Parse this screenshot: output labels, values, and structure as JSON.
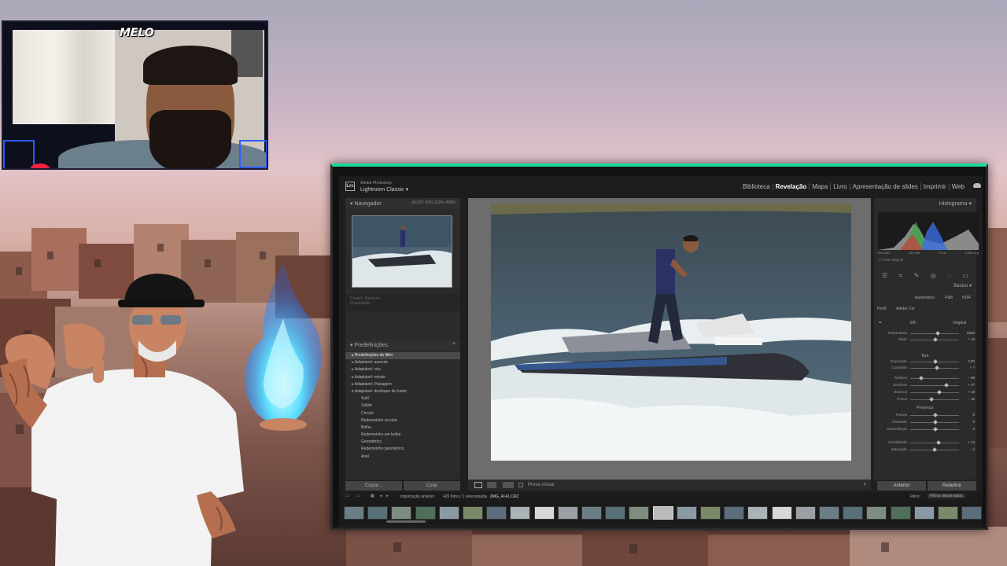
{
  "webcam": {
    "badge_text": "MELO"
  },
  "app": {
    "brand_small": "Adobe Photoshop",
    "title": "Lightroom Classic",
    "title_caret": "▾",
    "icon_text": "Lrc"
  },
  "modules": [
    "Biblioteca",
    "Revelação",
    "Mapa",
    "Livro",
    "Apresentação de slides",
    "Imprimir",
    "Web"
  ],
  "active_module": "Revelação",
  "left_panel": {
    "navigator_title": "Navegador",
    "navigator_options": "AJUST  50%  100%  400%",
    "snapshot_label": "Predef.: Nenhum",
    "snapshot_sub": "Quantidade",
    "presets_title": "Predefinições",
    "presets": [
      {
        "label": "▸ Predefinições do filtro",
        "sel": true
      },
      {
        "label": "▸ Adaptável: assunto",
        "sel": false
      },
      {
        "label": "▸ Adaptável: céu",
        "sel": false
      },
      {
        "label": "▸ Adaptável: retrato",
        "sel": false
      },
      {
        "label": "▸ Adaptável: Paisagem",
        "sel": false
      },
      {
        "label": "▾ Adaptável: desfoque de fundo",
        "sel": false
      },
      {
        "label": "Sutil",
        "sel": false,
        "indent": true
      },
      {
        "label": "Sólido",
        "sel": false,
        "indent": true
      },
      {
        "label": "Círculo",
        "sel": false,
        "indent": true
      },
      {
        "label": "Redemoinho circular",
        "sel": false,
        "indent": true
      },
      {
        "label": "Bolha",
        "sel": false,
        "indent": true
      },
      {
        "label": "Redemoinho em bolha",
        "sel": false,
        "indent": true
      },
      {
        "label": "Geométrico",
        "sel": false,
        "indent": true
      },
      {
        "label": "Redemoinho geométrico",
        "sel": false,
        "indent": true
      },
      {
        "label": "Anel",
        "sel": false,
        "indent": true
      }
    ],
    "copy_button": "Copiar...",
    "paste_button": "Colar"
  },
  "toolbar": {
    "proof_label": "Prova virtual"
  },
  "right_panel": {
    "histogram_title": "Histograma",
    "histo_labels": [
      "ISO 400",
      "300 mm",
      "f/ 5.6",
      "1/250 seg"
    ],
    "original_photo": "Foto Original",
    "basic_title": "Básico",
    "treatment_auto": "Automático",
    "treatment_pb": "P&B",
    "treatment_hdr": "HDR",
    "profile_label": "Perfil:",
    "profile_value": "Adobe Cor",
    "wb_label": "EB:",
    "wb_value": "Original",
    "tone_title": "Tom",
    "presence_title": "Presença",
    "sliders": [
      {
        "label": "Temperatura",
        "value": "5000",
        "pos": 0.55
      },
      {
        "label": "Matiz",
        "value": "+ 10",
        "pos": 0.5
      },
      {
        "label": "Exposição",
        "value": "0,00",
        "pos": 0.5
      },
      {
        "label": "Contraste",
        "value": "+ 7",
        "pos": 0.53
      },
      {
        "label": "Realces",
        "value": "− 59",
        "pos": 0.2
      },
      {
        "label": "Sombras",
        "value": "+ 47",
        "pos": 0.73
      },
      {
        "label": "Brancos",
        "value": "+ 18",
        "pos": 0.58
      },
      {
        "label": "Pretos",
        "value": "− 15",
        "pos": 0.42
      },
      {
        "label": "Textura",
        "value": "0",
        "pos": 0.5
      },
      {
        "label": "Claridade",
        "value": "0",
        "pos": 0.5
      },
      {
        "label": "Desembaçar",
        "value": "0",
        "pos": 0.5
      },
      {
        "label": "Vibratilidade",
        "value": "+ 14",
        "pos": 0.57
      },
      {
        "label": "Saturação",
        "value": "− 2",
        "pos": 0.49
      }
    ],
    "prev_button": "Anterior",
    "reset_button": "Redefinir"
  },
  "filmstrip": {
    "source": "Importação anterior",
    "count": "426 fotos / 1 selecionada",
    "filename": "/IMG_4141.CR2",
    "filter_label": "Filtro:",
    "filter_value": "Filtros desativados",
    "thumb_count": 27,
    "selected_index": 13
  },
  "colors": {
    "accent": "#1bd89a",
    "flame": "#36c6ff"
  }
}
